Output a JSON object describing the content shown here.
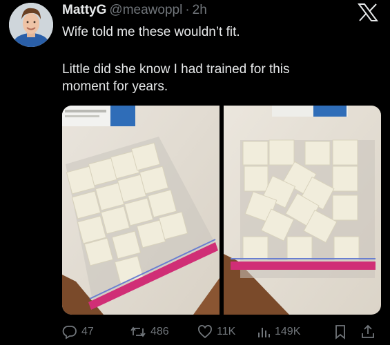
{
  "author": {
    "display_name": "MattyG",
    "handle": "@meawoppl",
    "separator": "·",
    "time": "2h",
    "avatar_icon": "profile-photo"
  },
  "tweet": {
    "line1": "Wife told me these wouldn’t fit.",
    "line2": "Little did she know I had trained for this",
    "line3": "moment for years."
  },
  "media": {
    "photos": [
      {
        "description_icon": "bag-of-cubes-photo"
      },
      {
        "description_icon": "bag-of-cubes-photo"
      }
    ]
  },
  "actions": {
    "replies": "47",
    "reposts": "486",
    "likes": "11K",
    "views": "149K"
  },
  "colors": {
    "background": "#000000",
    "text_primary": "#e7e9ea",
    "text_secondary": "#71767b"
  }
}
